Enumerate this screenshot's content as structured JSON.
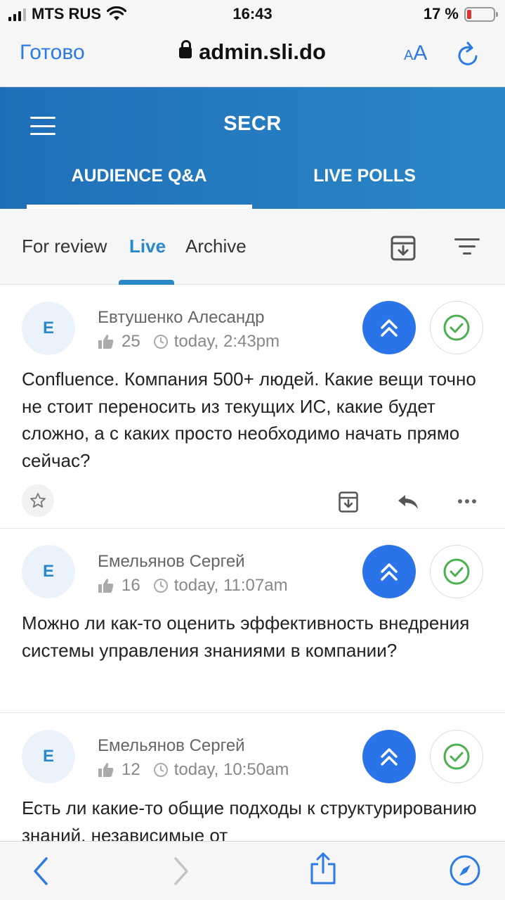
{
  "status_bar": {
    "carrier": "MTS RUS",
    "time": "16:43",
    "battery": "17 %",
    "battery_level": 0.17
  },
  "browser": {
    "done_label": "Готово",
    "url": "admin.sli.do",
    "text_size_label_small": "A",
    "text_size_label_large": "A"
  },
  "app": {
    "title": "SECR",
    "tabs": [
      {
        "label": "AUDIENCE Q&A",
        "active": true
      },
      {
        "label": "LIVE POLLS",
        "active": false
      }
    ],
    "subtabs": [
      {
        "label": "For review",
        "active": false
      },
      {
        "label": "Live",
        "active": true
      },
      {
        "label": "Archive",
        "active": false
      }
    ]
  },
  "questions": [
    {
      "avatar": "E",
      "author": "Евтушенко Алесандр",
      "likes": "25",
      "time": "today, 2:43pm",
      "text": "Confluence. Компания 500+ людей. Какие вещи точно не стоит переносить из текущих ИС, какие будет сложно, а с каких просто необходимо начать прямо сейчас?"
    },
    {
      "avatar": "E",
      "author": "Емельянов Сергей",
      "likes": "16",
      "time": "today, 11:07am",
      "text": "Можно ли как-то оценить эффективность внедрения системы управления знаниями в компании?"
    },
    {
      "avatar": "E",
      "author": "Емельянов Сергей",
      "likes": "12",
      "time": "today, 10:50am",
      "text": "Есть ли какие-то общие подходы к структурированию знаний, независимые от"
    }
  ],
  "colors": {
    "accent": "#2c87c8",
    "upvote": "#2a73e8",
    "approve": "#4caf50",
    "ios_blue": "#2c7be5"
  }
}
